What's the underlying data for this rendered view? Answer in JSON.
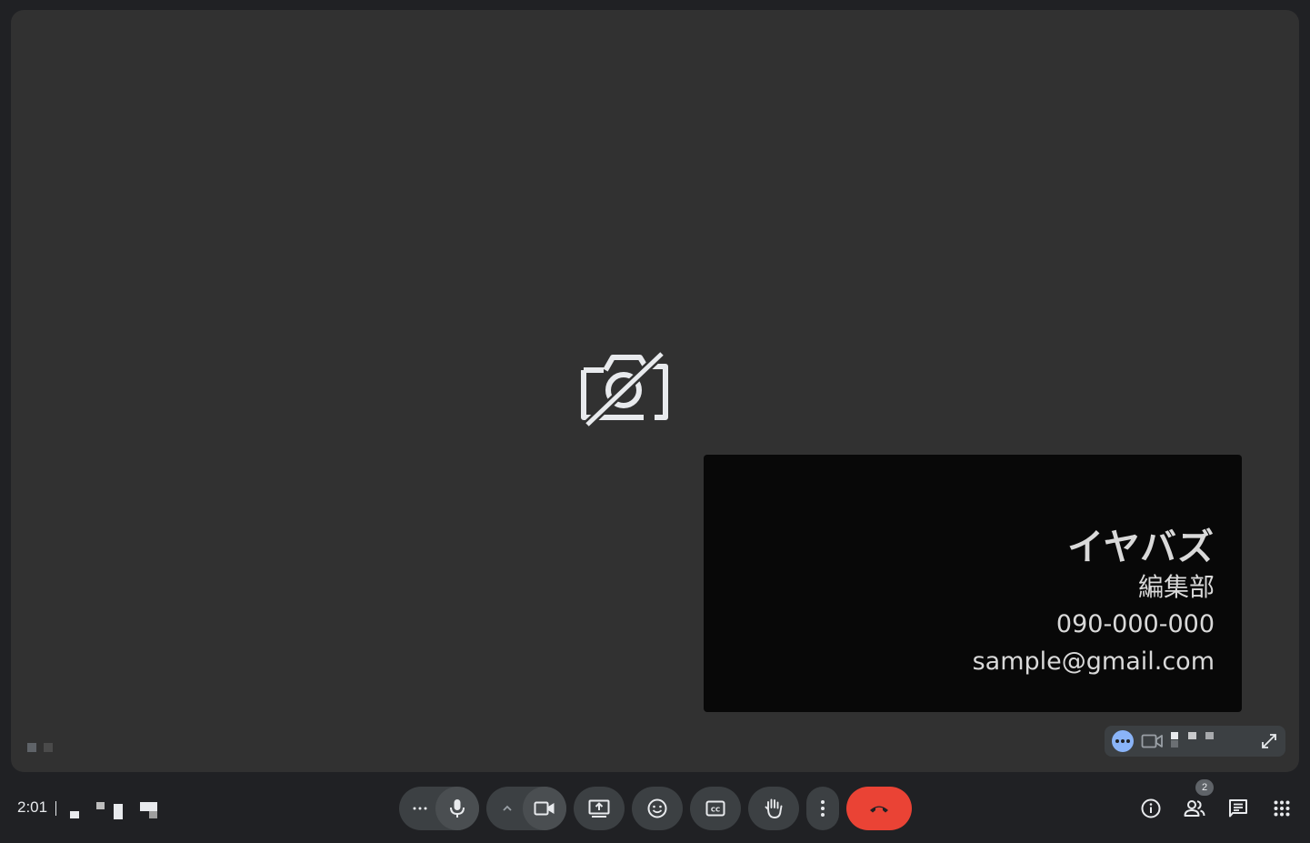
{
  "main_tile": {
    "camera_off_icon": "videocam-off-icon"
  },
  "self_view": {
    "name": "イヤバズ",
    "department": "編集部",
    "phone": "090-000-000",
    "email": "sample@gmail.com",
    "toolbar": {
      "more_icon": "more-horiz-icon",
      "camera_icon": "videocam-icon",
      "expand_icon": "expand-icon"
    }
  },
  "bottom_bar": {
    "time": "2:01",
    "controls": {
      "more_audio_options": "more-horiz-icon",
      "mic": "mic-icon",
      "more_video_options": "chevron-up-icon",
      "camera": "videocam-icon",
      "present": "present-screen-icon",
      "reactions": "emoji-icon",
      "captions": "closed-caption-icon",
      "raise_hand": "hand-icon",
      "more_options": "more-vert-icon",
      "leave_call": "call-end-icon"
    },
    "right": {
      "info": "info-icon",
      "people": "people-icon",
      "people_count": "2",
      "chat": "chat-icon",
      "activities": "apps-icon"
    }
  },
  "colors": {
    "background": "#202124",
    "stage": "#313131",
    "control": "#3c4043",
    "hangup": "#ea4335",
    "accent": "#8ab4f8"
  }
}
